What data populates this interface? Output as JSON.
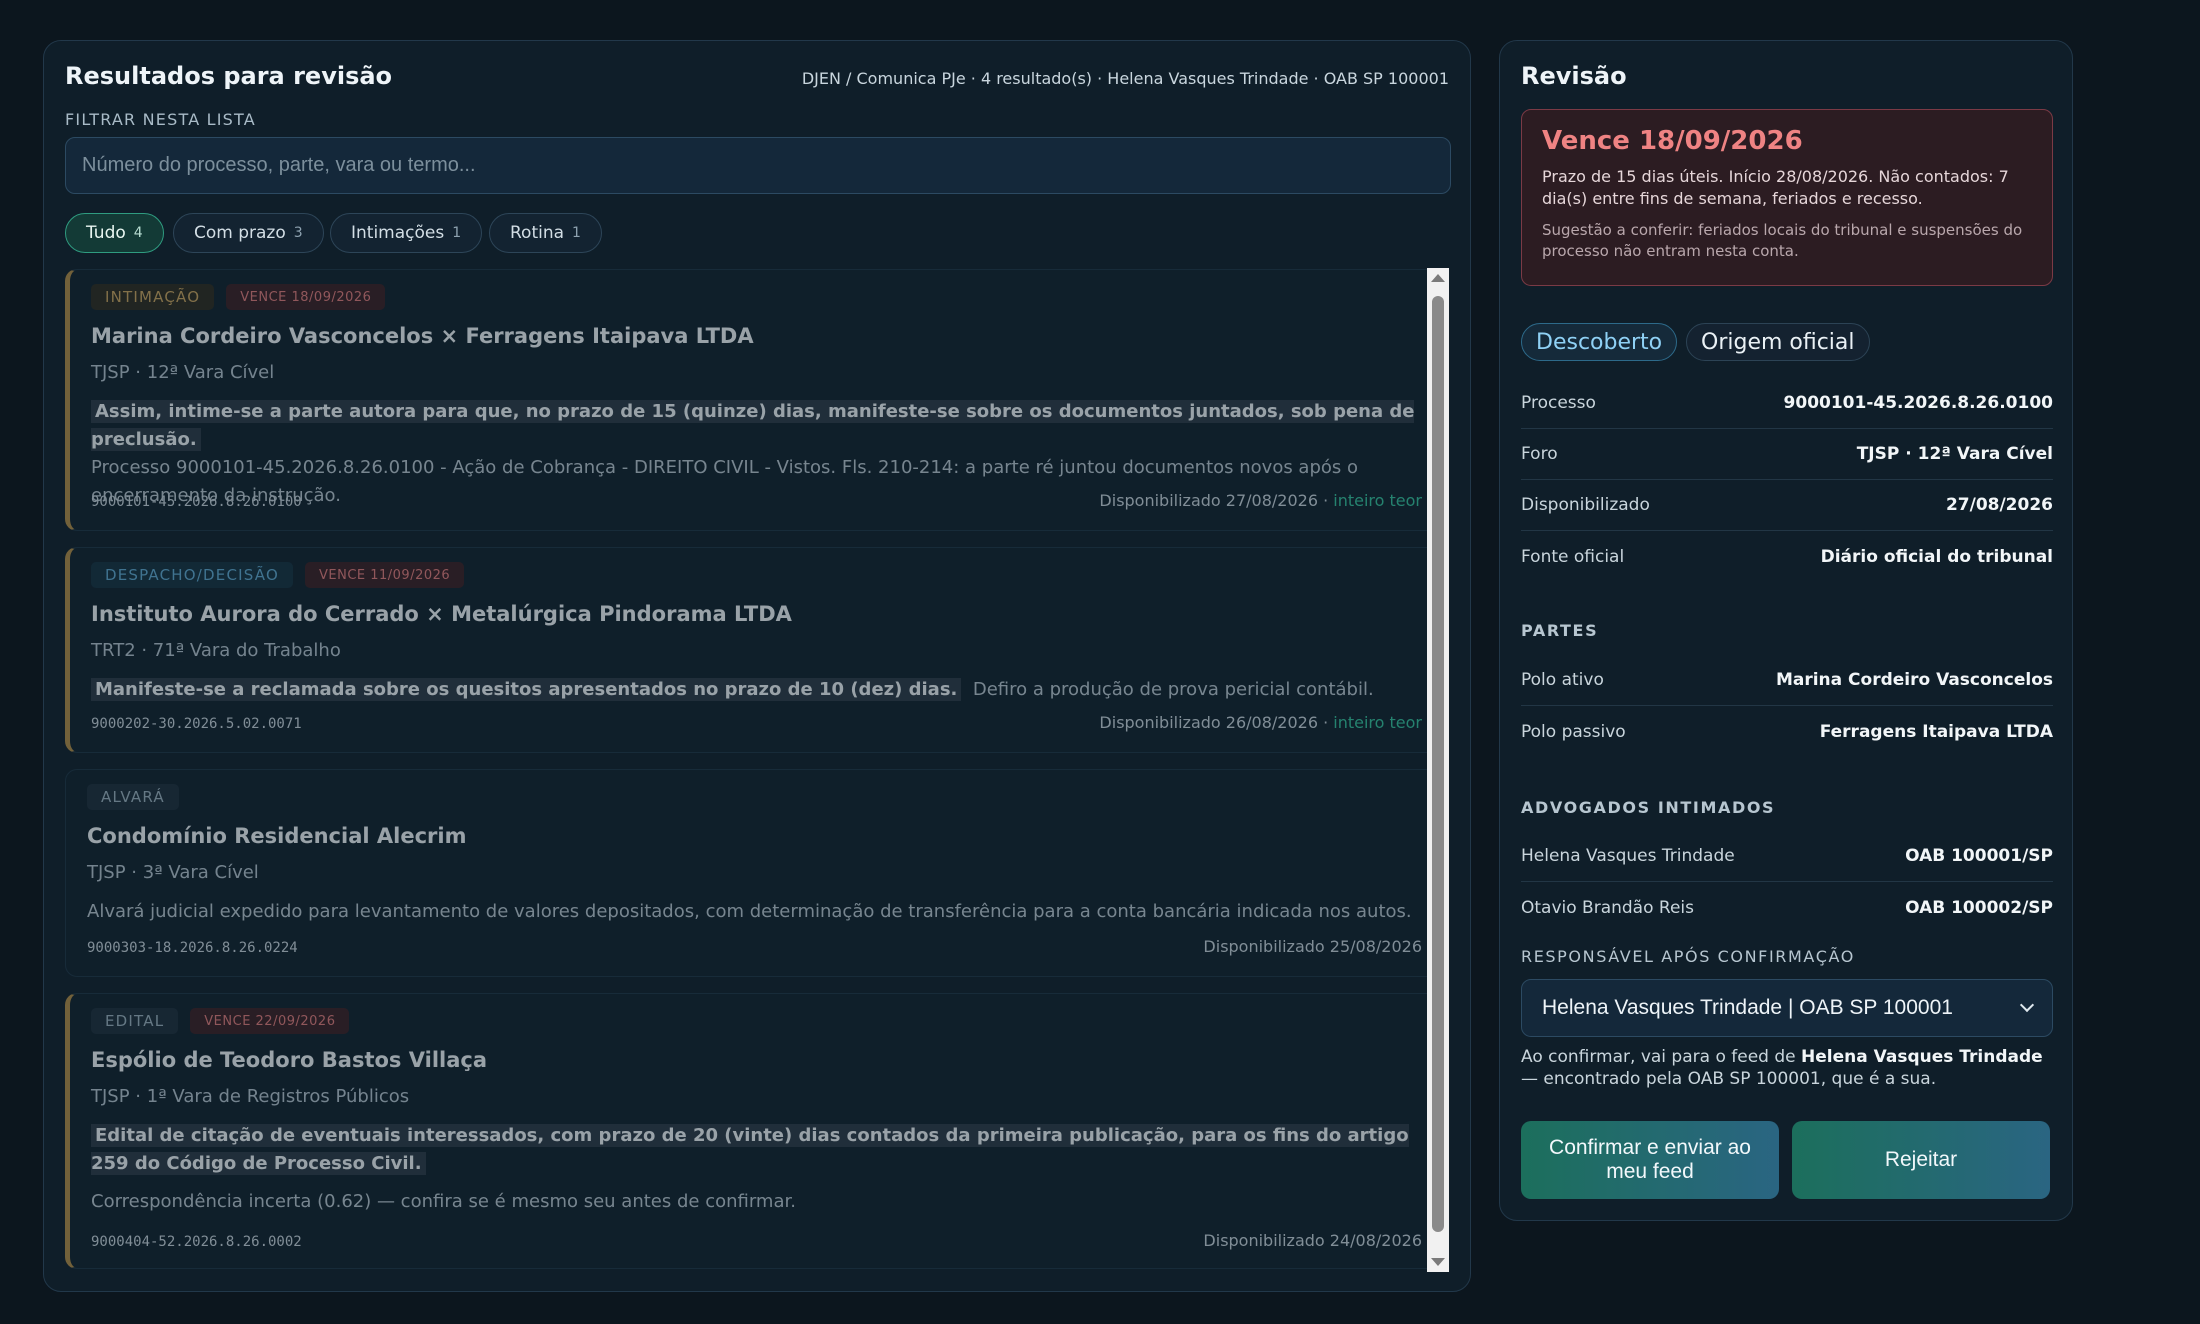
{
  "results": {
    "title": "Resultados para revisão",
    "meta": "DJEN / Comunica PJe · 4 resultado(s) · Helena Vasques Trindade · OAB SP 100001",
    "filter_label": "FILTRAR NESTA LISTA",
    "filter_placeholder": "Número do processo, parte, vara ou termo...",
    "filter_value": "",
    "chips": [
      {
        "label": "Tudo",
        "count": "4",
        "active": true
      },
      {
        "label": "Com prazo",
        "count": "3",
        "active": false
      },
      {
        "label": "Intimações",
        "count": "1",
        "active": false
      },
      {
        "label": "Rotina",
        "count": "1",
        "active": false
      }
    ],
    "items": [
      {
        "type": "INTIMAÇÃO",
        "due": "VENCE 18/09/2026",
        "title": "Marina Cordeiro Vasconcelos × Ferragens Itaipava LTDA",
        "court": "TJSP · 12ª Vara Cível",
        "highlight": "Assim, intime-se a parte autora para que, no prazo de 15 (quinze) dias, manifeste-se sobre os documentos juntados, sob pena de preclusão.",
        "text": "Processo 9000101-45.2026.8.26.0100 - Ação de Cobrança - DIREITO CIVIL - Vistos. Fls. 210-214: a parte ré juntou documentos novos após o encerramento da instrução.",
        "number": "9000101-45.2026.8.26.0100",
        "available": "Disponibilizado 27/08/2026",
        "link": "inteiro teor"
      },
      {
        "type": "DESPACHO/DECISÃO",
        "due": "VENCE 11/09/2026",
        "title": "Instituto Aurora do Cerrado × Metalúrgica Pindorama LTDA",
        "court": "TRT2 · 71ª Vara do Trabalho",
        "highlight": "Manifeste-se a reclamada sobre os quesitos apresentados no prazo de 10 (dez) dias.",
        "text": "Defiro a produção de prova pericial contábil.",
        "number": "9000202-30.2026.5.02.0071",
        "available": "Disponibilizado 26/08/2026",
        "link": "inteiro teor"
      },
      {
        "type": "ALVARÁ",
        "title": "Condomínio Residencial Alecrim",
        "court": "TJSP · 3ª Vara Cível",
        "text": "Alvará judicial expedido para levantamento de valores depositados, com determinação de transferência para a conta bancária indicada nos autos.",
        "number": "9000303-18.2026.8.26.0224",
        "available": "Disponibilizado 25/08/2026"
      },
      {
        "type": "EDITAL",
        "due": "VENCE 22/09/2026",
        "title": "Espólio de Teodoro Bastos Villaça",
        "court": "TJSP · 1ª Vara de Registros Públicos",
        "highlight": "Edital de citação de eventuais interessados, com prazo de 20 (vinte) dias contados da primeira publicação, para os fins do artigo 259 do Código de Processo Civil.",
        "text": "Correspondência incerta (0.62) — confira se é mesmo seu antes de confirmar.",
        "number": "9000404-52.2026.8.26.0002",
        "available": "Disponibilizado 24/08/2026"
      }
    ]
  },
  "review": {
    "title": "Revisão",
    "due_title": "Vence 18/09/2026",
    "due_desc": "Prazo de 15 dias úteis. Início 28/08/2026. Não contados: 7 dia(s) entre fins de semana, feriados e recesso.",
    "due_hint": "Sugestão a conferir: feriados locais do tribunal e suspensões do processo não entram nesta conta.",
    "tags": [
      "Descoberto",
      "Origem oficial"
    ],
    "fields": [
      {
        "k": "Processo",
        "v": "9000101-45.2026.8.26.0100"
      },
      {
        "k": "Foro",
        "v": "TJSP · 12ª Vara Cível"
      },
      {
        "k": "Disponibilizado",
        "v": "27/08/2026"
      },
      {
        "k": "Fonte oficial",
        "v": "Diário oficial do tribunal"
      }
    ],
    "parties_label": "PARTES",
    "parties": [
      {
        "k": "Polo ativo",
        "v": "Marina Cordeiro Vasconcelos"
      },
      {
        "k": "Polo passivo",
        "v": "Ferragens Itaipava LTDA"
      }
    ],
    "lawyers_label": "ADVOGADOS INTIMADOS",
    "lawyers": [
      {
        "k": "Helena Vasques Trindade",
        "v": "OAB 100001/SP"
      },
      {
        "k": "Otavio Brandão Reis",
        "v": "OAB 100002/SP"
      }
    ],
    "responsible_label": "RESPONSÁVEL APÓS CONFIRMAÇÃO",
    "responsible_value": "Helena Vasques Trindade | OAB SP 100001",
    "note_prefix": "Ao confirmar, vai para o feed de ",
    "note_name": "Helena Vasques Trindade",
    "note_suffix": " — encontrado pela OAB SP 100001, que é a sua.",
    "confirm_label": "Confirmar e enviar ao meu feed",
    "reject_label": "Rejeitar"
  }
}
